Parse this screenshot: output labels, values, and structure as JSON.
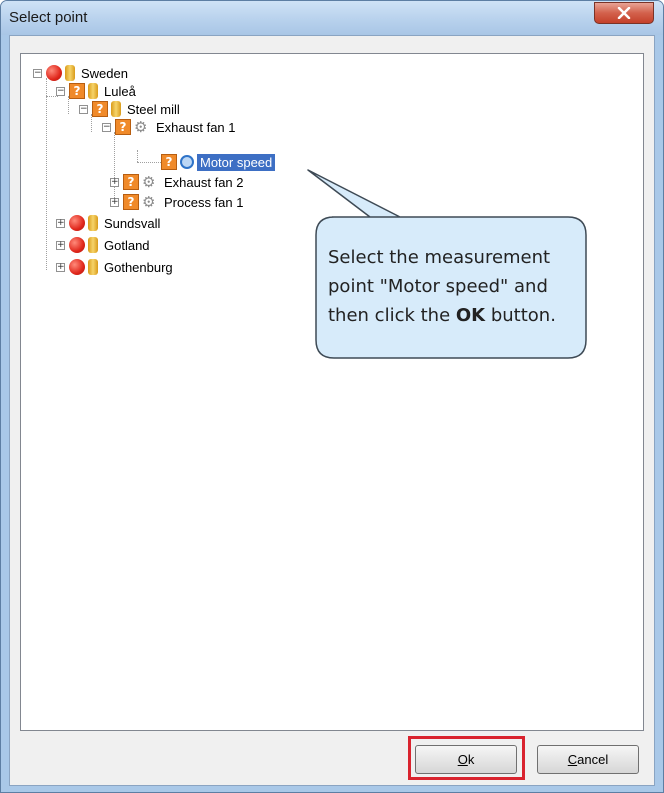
{
  "window": {
    "title": "Select point"
  },
  "tree": [
    {
      "label": "Sweden",
      "icon": "red-status-dot",
      "icon2": "database-icon",
      "expander": "−"
    },
    {
      "label": "Luleå",
      "icon": "unknown-status-icon",
      "icon2": "folder-icon",
      "expander": "−"
    },
    {
      "label": "Steel mill",
      "icon": "unknown-status-icon",
      "icon2": "folder-icon",
      "expander": "−"
    },
    {
      "label": "Exhaust fan 1",
      "icon": "unknown-status-icon",
      "icon2": "gear-icon",
      "expander": "−"
    },
    {
      "label": "Motor speed",
      "icon": "unknown-status-icon",
      "icon2": "measurement-point-icon",
      "selected": true
    },
    {
      "label": "Exhaust fan 2",
      "icon": "unknown-status-icon",
      "icon2": "gear-icon",
      "expander": "+"
    },
    {
      "label": "Process fan 1",
      "icon": "unknown-status-icon",
      "icon2": "gear-icon",
      "expander": "+"
    },
    {
      "label": "Sundsvall",
      "icon": "red-status-dot",
      "icon2": "folder-icon",
      "expander": "+"
    },
    {
      "label": "Gotland",
      "icon": "red-status-dot",
      "icon2": "folder-icon",
      "expander": "+"
    },
    {
      "label": "Gothenburg",
      "icon": "red-status-dot",
      "icon2": "folder-icon",
      "expander": "+"
    }
  ],
  "callout": {
    "line1": "Select the measurement",
    "line2": "point \"Motor speed\" and",
    "line3_pre": "then click the ",
    "line3_bold": "OK",
    "line3_post": " button."
  },
  "buttons": {
    "ok_mnemonic": "O",
    "ok_rest": "k",
    "cancel_mnemonic": "C",
    "cancel_rest": "ancel"
  },
  "colors": {
    "title_bar": "#b6d0ec",
    "selection": "#3d6fc4",
    "callout_fill": "#d7ebfa",
    "highlight_box": "#d9232e"
  }
}
